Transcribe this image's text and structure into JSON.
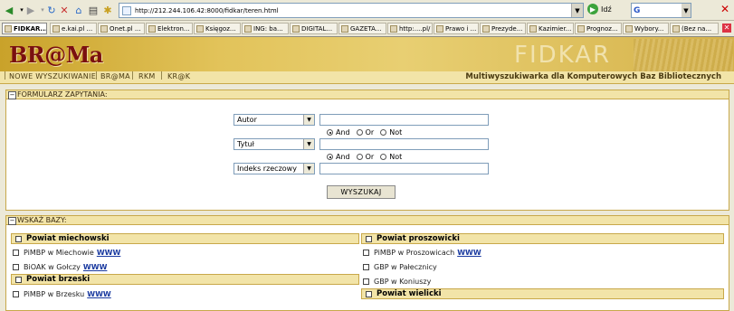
{
  "browser": {
    "url": "http://212.244.106.42:8000/fidkar/teren.html",
    "go_label": "Idź",
    "tabs": [
      "FIDKAR...",
      "e.kai.pl ...",
      "Onet.pl ...",
      "Elektron...",
      "Księgoz...",
      "ING: ba...",
      "DIGITAL...",
      "GAZETA...",
      "http:....pl/",
      "Prawo i ...",
      "Prezyde...",
      "Kazimier...",
      "Prognoz...",
      "Wybory...",
      "(Bez na..."
    ]
  },
  "header": {
    "brand": "BR@Ma",
    "product": "FIDKAR",
    "nav": [
      "NOWE WYSZUKIWANIE",
      "BR@MA",
      "RKM",
      "KR@K"
    ],
    "subtitle": "Multiwyszukiwarka dla Komputerowych Baz Bibliotecznych"
  },
  "form": {
    "section_title": "FORMULARZ ZAPYTANIA:",
    "fields": [
      {
        "select": "Autor",
        "value": ""
      },
      {
        "select": "Tytuł",
        "value": ""
      },
      {
        "select": "Indeks rzeczowy",
        "value": ""
      }
    ],
    "operators": [
      "And",
      "Or",
      "Not"
    ],
    "selected_operator": "And",
    "submit_label": "WYSZUKAJ"
  },
  "databases": {
    "section_title": "WSKAŻ BAZY:",
    "link_label": "WWW",
    "left": [
      {
        "group": "Powiat miechowski",
        "items": [
          {
            "name": "PiMBP w Miechowie",
            "link": true
          },
          {
            "name": "BiOAK w Gołczy",
            "link": true
          }
        ]
      },
      {
        "group": "Powiat brzeski",
        "items": [
          {
            "name": "PiMBP w Brzesku",
            "link": true
          }
        ]
      }
    ],
    "right": [
      {
        "group": "Powiat proszowicki",
        "items": [
          {
            "name": "PiMBP w Proszowicach",
            "link": true
          },
          {
            "name": "GBP w Pałecznicy",
            "link": false
          },
          {
            "name": "GBP w Koniuszy",
            "link": false
          }
        ]
      },
      {
        "group": "Powiat wielicki",
        "items": []
      }
    ]
  }
}
